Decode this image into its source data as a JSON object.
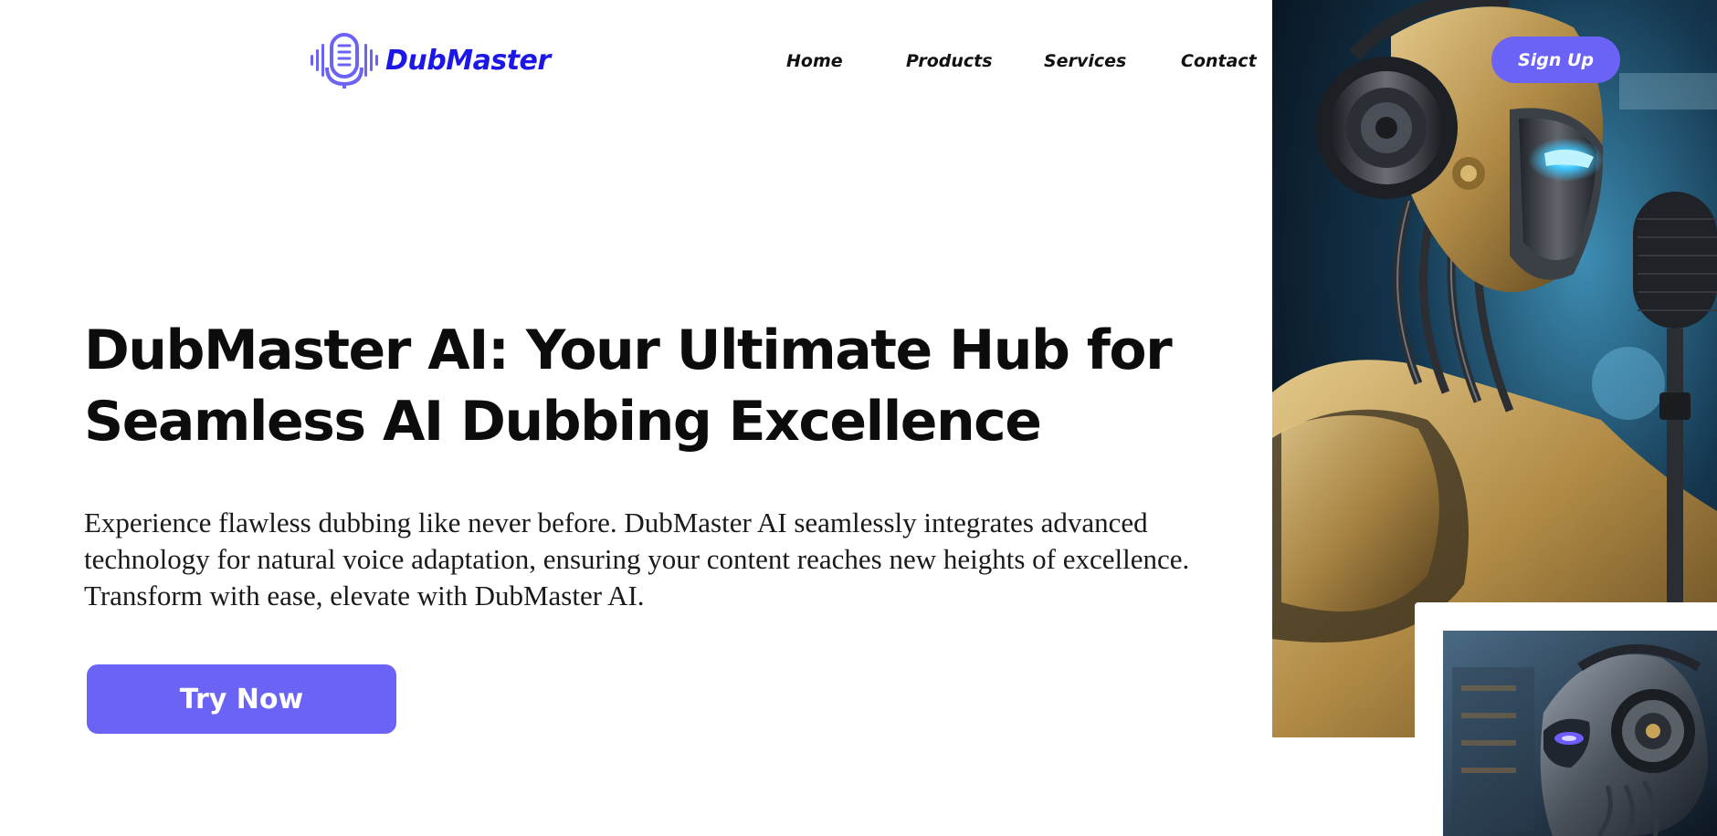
{
  "brand": {
    "name": "DubMaster",
    "color": "#1d17e6",
    "icon": "microphone-waveform-icon"
  },
  "nav": {
    "items": [
      {
        "label": "Home"
      },
      {
        "label": "Products"
      },
      {
        "label": "Services"
      },
      {
        "label": "Contact"
      }
    ],
    "signup_label": "Sign Up"
  },
  "hero": {
    "title": "DubMaster AI: Your Ultimate Hub for Seamless AI Dubbing Excellence",
    "description": "Experience flawless dubbing like never before. DubMaster AI seamlessly integrates advanced technology for natural voice adaptation, ensuring your content reaches new heights of excellence. Transform with ease, elevate with DubMaster AI.",
    "cta_label": "Try Now"
  },
  "images": {
    "main": "robot-with-headphones-and-studio-microphone",
    "secondary": "robot-head-with-headphones-in-server-room"
  },
  "colors": {
    "accent": "#6b63f6",
    "text": "#111111",
    "background": "#ffffff"
  }
}
